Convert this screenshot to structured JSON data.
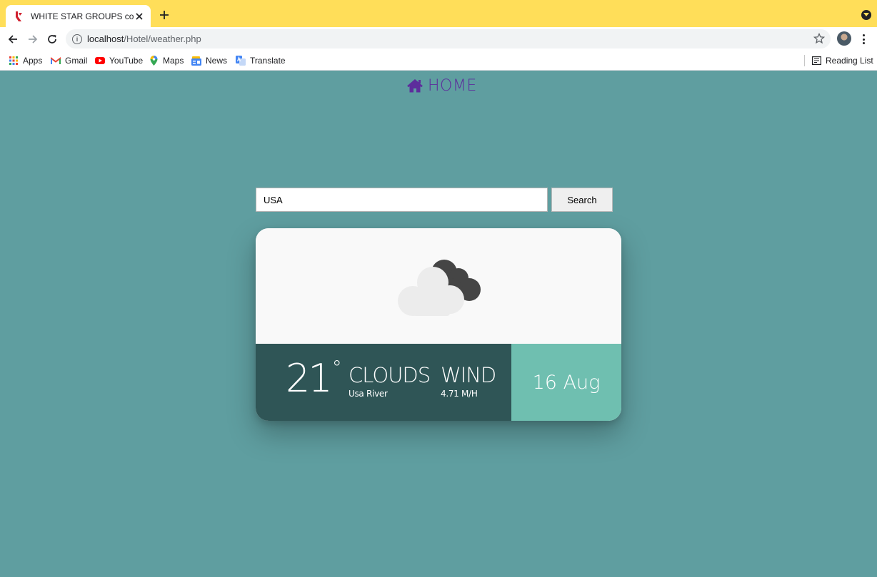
{
  "browser": {
    "tab_title": "WHITE STAR GROUPS co.Ltd",
    "url_host": "localhost",
    "url_path": "/Hotel/weather.php",
    "bookmarks": [
      {
        "label": "Apps",
        "icon": "apps-grid-icon"
      },
      {
        "label": "Gmail",
        "icon": "gmail-icon"
      },
      {
        "label": "YouTube",
        "icon": "youtube-icon"
      },
      {
        "label": "Maps",
        "icon": "maps-pin-icon"
      },
      {
        "label": "News",
        "icon": "news-icon"
      },
      {
        "label": "Translate",
        "icon": "translate-icon"
      }
    ],
    "reading_list": "Reading List",
    "theme_color": "#ffde59"
  },
  "page": {
    "home_label": "HOME",
    "home_color": "#5d2d9c",
    "background": "#5f9ea0",
    "search": {
      "value": "USA",
      "button_label": "Search"
    },
    "weather": {
      "icon": "cloudy-night-icon",
      "temperature": "21",
      "degree_symbol": "°",
      "condition": "CLOUDS",
      "location": "Usa River",
      "wind_label": "WIND",
      "wind_speed": "4.71 M/H",
      "date": "16 Aug",
      "colors": {
        "panel": "#2f5556",
        "date_panel": "#6fbfb0"
      }
    }
  }
}
